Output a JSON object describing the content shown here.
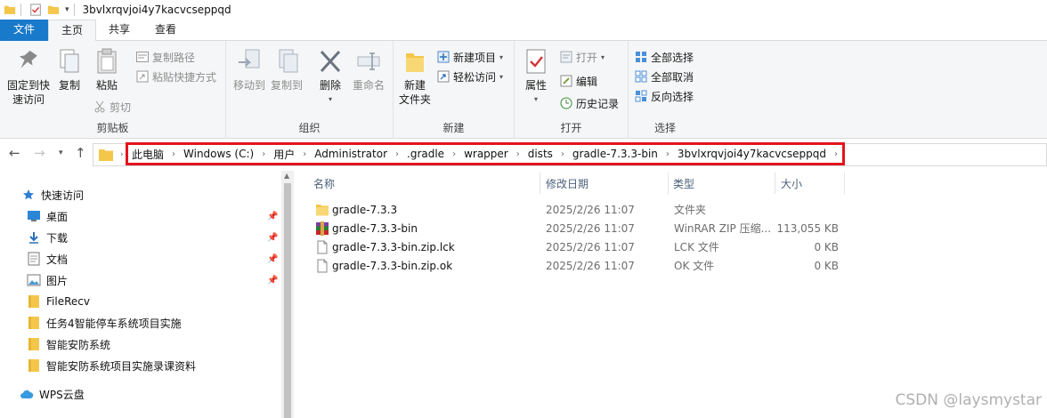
{
  "window": {
    "title": "3bvlxrqvjoi4y7kacvcseppqd"
  },
  "tabs": [
    {
      "label": "文件"
    },
    {
      "label": "主页"
    },
    {
      "label": "共享"
    },
    {
      "label": "查看"
    }
  ],
  "ribbon": {
    "clipboard": {
      "label": "剪贴板",
      "pin": "固定到快\n速访问",
      "copy": "复制",
      "paste": "粘贴",
      "copy_path": "复制路径",
      "paste_shortcut": "粘贴快捷方式",
      "cut": "剪切"
    },
    "organize": {
      "label": "组织",
      "move_to": "移动到",
      "copy_to": "复制到",
      "delete": "删除",
      "rename": "重命名"
    },
    "new": {
      "label": "新建",
      "new_folder": "新建\n文件夹",
      "new_item": "新建项目",
      "easy_access": "轻松访问"
    },
    "open": {
      "label": "打开",
      "properties": "属性",
      "open": "打开",
      "edit": "编辑",
      "history": "历史记录"
    },
    "select": {
      "label": "选择",
      "select_all": "全部选择",
      "select_none": "全部取消",
      "invert": "反向选择"
    }
  },
  "breadcrumb": [
    "此电脑",
    "Windows (C:)",
    "用户",
    "Administrator",
    ".gradle",
    "wrapper",
    "dists",
    "gradle-7.3.3-bin",
    "3bvlxrqvjoi4y7kacvcseppqd"
  ],
  "navpane": {
    "items": [
      {
        "label": "快速访问",
        "icon": "star-icon"
      },
      {
        "label": "桌面",
        "icon": "desktop-icon"
      },
      {
        "label": "下载",
        "icon": "download-icon"
      },
      {
        "label": "文档",
        "icon": "document-icon"
      },
      {
        "label": "图片",
        "icon": "picture-icon"
      },
      {
        "label": "FileRecv",
        "icon": "folder-icon"
      },
      {
        "label": "任务4智能停车系统项目实施",
        "icon": "folder-icon"
      },
      {
        "label": "智能安防系统",
        "icon": "folder-icon"
      },
      {
        "label": "智能安防系统项目实施录课资料",
        "icon": "folder-icon"
      },
      {
        "label": "WPS云盘",
        "icon": "cloud-icon"
      }
    ]
  },
  "columns": {
    "name": "名称",
    "date": "修改日期",
    "type": "类型",
    "size": "大小"
  },
  "files": [
    {
      "name": "gradle-7.3.3",
      "date": "2025/2/26 11:07",
      "type": "文件夹",
      "size": "",
      "icon": "folder-icon"
    },
    {
      "name": "gradle-7.3.3-bin",
      "date": "2025/2/26 11:07",
      "type": "WinRAR ZIP 压缩...",
      "size": "113,055 KB",
      "icon": "winrar-icon"
    },
    {
      "name": "gradle-7.3.3-bin.zip.lck",
      "date": "2025/2/26 11:07",
      "type": "LCK 文件",
      "size": "0 KB",
      "icon": "file-icon"
    },
    {
      "name": "gradle-7.3.3-bin.zip.ok",
      "date": "2025/2/26 11:07",
      "type": "OK 文件",
      "size": "0 KB",
      "icon": "file-icon"
    }
  ],
  "watermark": "CSDN @laysmystar"
}
